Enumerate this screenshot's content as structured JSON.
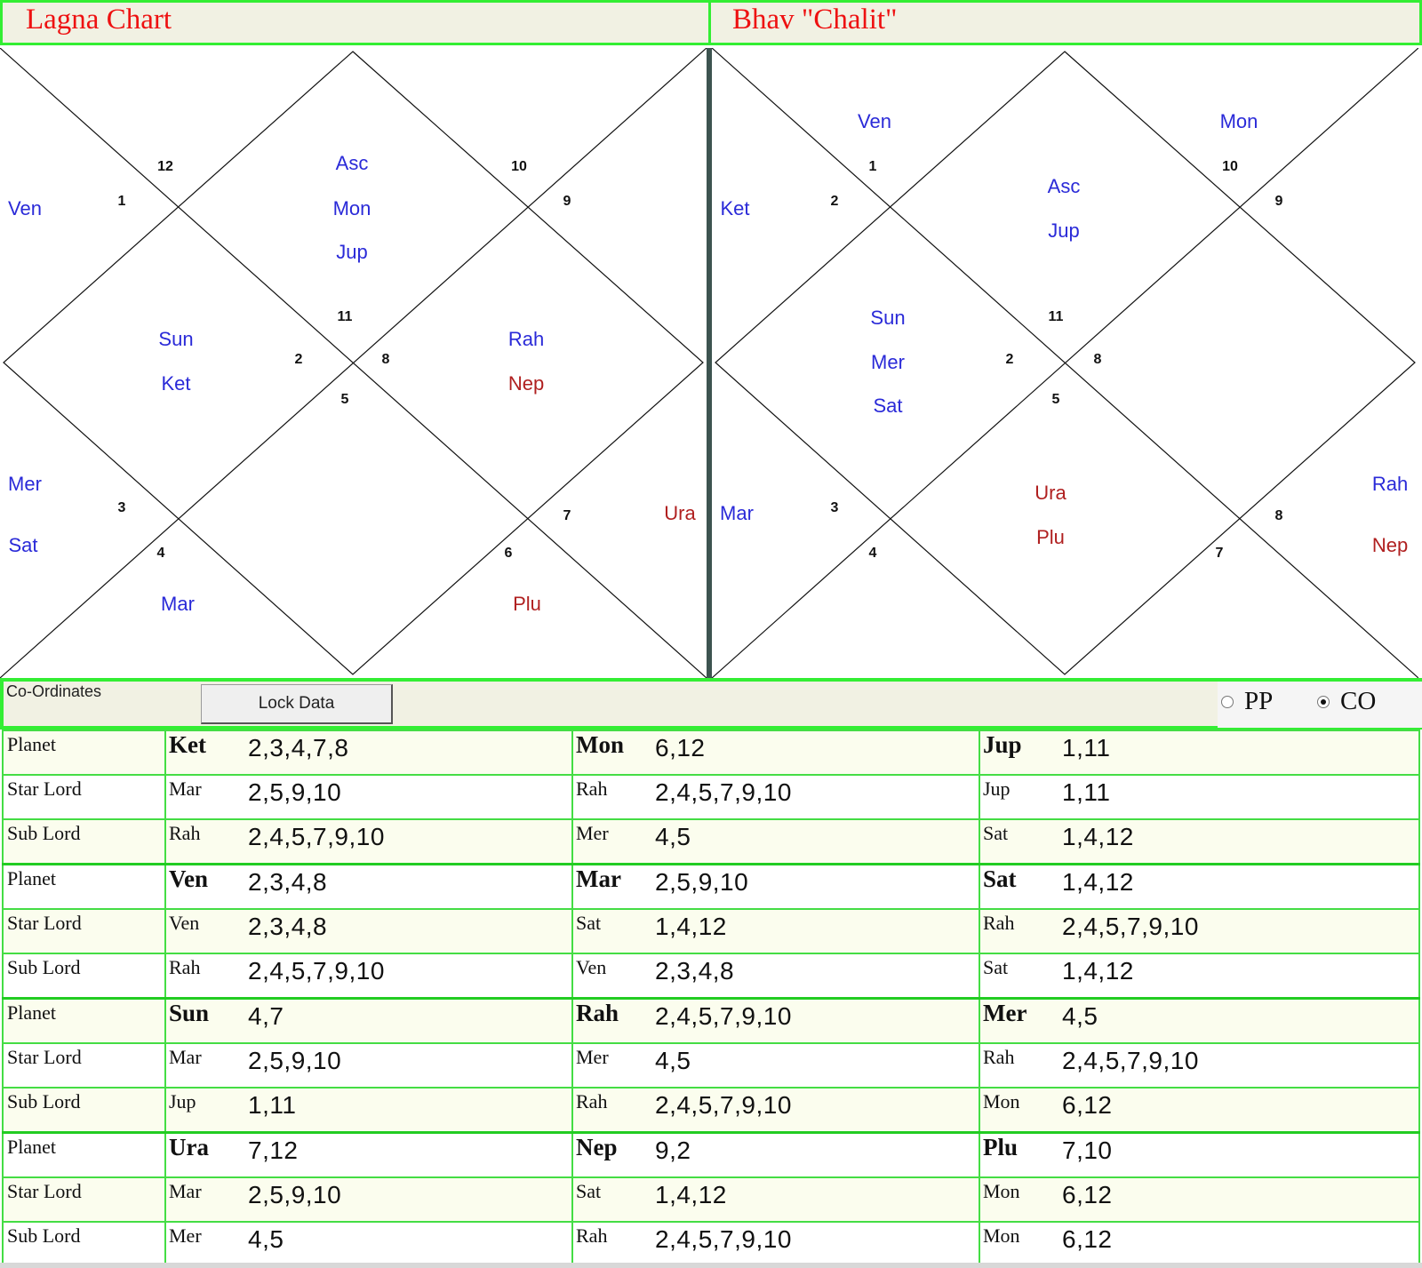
{
  "titles": {
    "left": "Lagna Chart",
    "right": "Bhav \"Chalit\""
  },
  "lagna_chart": {
    "house_numbers": [
      "12",
      "10",
      "1",
      "9",
      "11",
      "2",
      "8",
      "5",
      "3",
      "7",
      "4",
      "6"
    ],
    "planets": {
      "h1": [
        "Asc",
        "Mon",
        "Jup"
      ],
      "h2_left": [
        "Ven"
      ],
      "h_left_inner": [
        "Sun",
        "Ket"
      ],
      "h_right_inner": [
        "Rah",
        "Nep"
      ],
      "h_left_outer": [
        "Mer",
        "Sat"
      ],
      "h_right_outer": [
        "Ura"
      ],
      "h_bottom_left": [
        "Mar"
      ],
      "h_bottom_right": [
        "Plu"
      ]
    }
  },
  "bhav_chart": {
    "house_numbers": [
      "1",
      "10",
      "2",
      "9",
      "11",
      "2",
      "8",
      "5",
      "3",
      "8",
      "4",
      "7"
    ],
    "planets": {
      "top_left": [
        "Ven"
      ],
      "top_right": [
        "Mon"
      ],
      "center_top": [
        "Asc",
        "Jup"
      ],
      "left_upper": [
        "Ket"
      ],
      "left_inner": [
        "Sun",
        "Mer",
        "Sat"
      ],
      "bottom_center": [
        "Ura",
        "Plu"
      ],
      "left_lower": [
        "Mar"
      ],
      "right_lower": [
        "Rah",
        "Nep"
      ]
    }
  },
  "coord_bar": {
    "label": "Co-Ordinates",
    "lock_button": "Lock Data",
    "radio_pp": "PP",
    "radio_co": "CO",
    "selected": "CO"
  },
  "row_heads": [
    "Planet",
    "Star Lord",
    "Sub Lord"
  ],
  "groups": [
    [
      [
        [
          "Ket",
          "2,3,4,7,8"
        ],
        [
          "Mon",
          "6,12"
        ],
        [
          "Jup",
          "1,11"
        ]
      ],
      [
        [
          "Mar",
          "2,5,9,10"
        ],
        [
          "Rah",
          "2,4,5,7,9,10"
        ],
        [
          "Jup",
          "1,11"
        ]
      ],
      [
        [
          "Rah",
          "2,4,5,7,9,10"
        ],
        [
          "Mer",
          "4,5"
        ],
        [
          "Sat",
          "1,4,12"
        ]
      ]
    ],
    [
      [
        [
          "Ven",
          "2,3,4,8"
        ],
        [
          "Mar",
          "2,5,9,10"
        ],
        [
          "Sat",
          "1,4,12"
        ]
      ],
      [
        [
          "Ven",
          "2,3,4,8"
        ],
        [
          "Sat",
          "1,4,12"
        ],
        [
          "Rah",
          "2,4,5,7,9,10"
        ]
      ],
      [
        [
          "Rah",
          "2,4,5,7,9,10"
        ],
        [
          "Ven",
          "2,3,4,8"
        ],
        [
          "Sat",
          "1,4,12"
        ]
      ]
    ],
    [
      [
        [
          "Sun",
          "4,7"
        ],
        [
          "Rah",
          "2,4,5,7,9,10"
        ],
        [
          "Mer",
          "4,5"
        ]
      ],
      [
        [
          "Mar",
          "2,5,9,10"
        ],
        [
          "Mer",
          "4,5"
        ],
        [
          "Rah",
          "2,4,5,7,9,10"
        ]
      ],
      [
        [
          "Jup",
          "1,11"
        ],
        [
          "Rah",
          "2,4,5,7,9,10"
        ],
        [
          "Mon",
          "6,12"
        ]
      ]
    ],
    [
      [
        [
          "Ura",
          "7,12"
        ],
        [
          "Nep",
          "9,2"
        ],
        [
          "Plu",
          "7,10"
        ]
      ],
      [
        [
          "Mar",
          "2,5,9,10"
        ],
        [
          "Sat",
          "1,4,12"
        ],
        [
          "Mon",
          "6,12"
        ]
      ],
      [
        [
          "Mer",
          "4,5"
        ],
        [
          "Rah",
          "2,4,5,7,9,10"
        ],
        [
          "Mon",
          "6,12"
        ]
      ]
    ]
  ]
}
